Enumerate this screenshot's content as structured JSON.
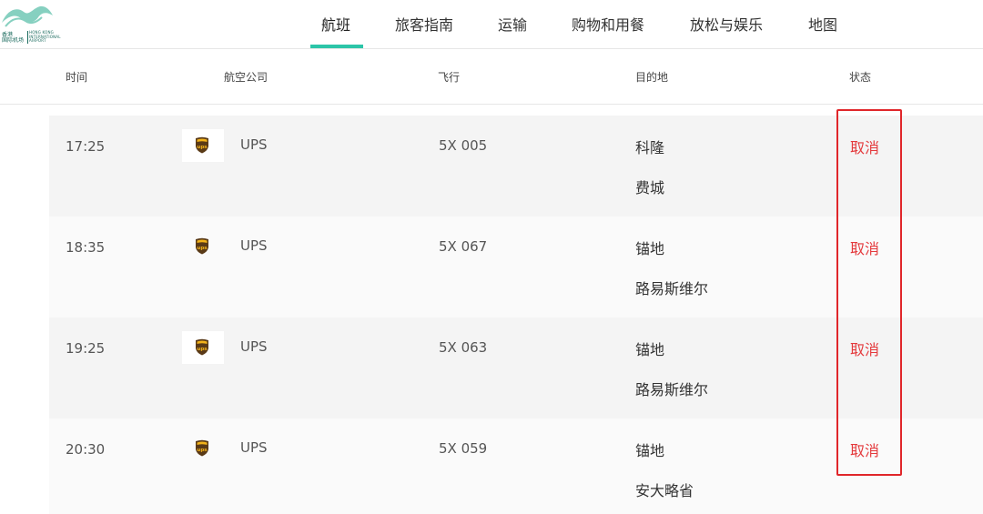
{
  "logo": {
    "cn_line1": "香港",
    "cn_line2": "国际机场",
    "en_line1": "HONG KONG",
    "en_line2": "INTERNATIONAL",
    "en_line3": "AIRPORT",
    "brand_color": "#1b6b5e",
    "accent_color": "#86d0c0"
  },
  "nav": {
    "items": [
      {
        "label": "航班",
        "active": true
      },
      {
        "label": "旅客指南",
        "active": false
      },
      {
        "label": "运输",
        "active": false
      },
      {
        "label": "购物和用餐",
        "active": false
      },
      {
        "label": "放松与娱乐",
        "active": false
      },
      {
        "label": "地图",
        "active": false
      }
    ],
    "active_color": "#2cc5a8"
  },
  "table": {
    "headers": {
      "time": "时间",
      "airline": "航空公司",
      "flight": "飞行",
      "destination": "目的地",
      "status": "状态"
    },
    "rows": [
      {
        "time": "17:25",
        "airline": "UPS",
        "flight": "5X 005",
        "dest1": "科隆",
        "dest2": "费城",
        "status": "取消",
        "airline_icon": "ups-shield-icon"
      },
      {
        "time": "18:35",
        "airline": "UPS",
        "flight": "5X 067",
        "dest1": "锚地",
        "dest2": "路易斯维尔",
        "status": "取消",
        "airline_icon": "ups-shield-icon"
      },
      {
        "time": "19:25",
        "airline": "UPS",
        "flight": "5X 063",
        "dest1": "锚地",
        "dest2": "路易斯维尔",
        "status": "取消",
        "airline_icon": "ups-shield-icon"
      },
      {
        "time": "20:30",
        "airline": "UPS",
        "flight": "5X 059",
        "dest1": "锚地",
        "dest2": "安大略省",
        "status": "取消",
        "airline_icon": "ups-shield-icon"
      }
    ],
    "status_color": "#e4393c",
    "highlight_color": "#e0262a"
  }
}
